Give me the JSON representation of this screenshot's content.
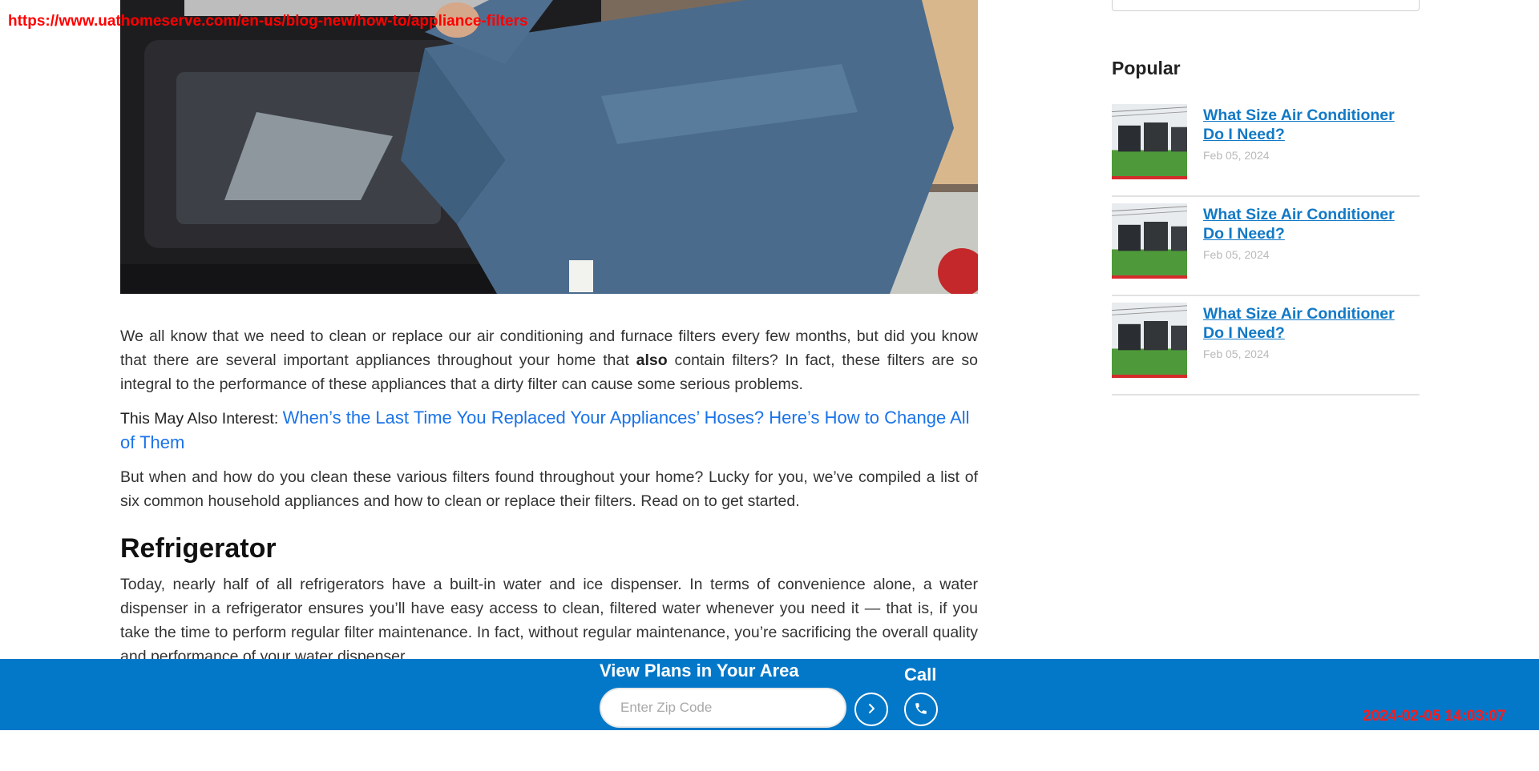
{
  "url_overlay": "https://www.uathomeserve.com/en-us/blog-new/how-to/appliance-filters",
  "article": {
    "para1_part1": "We all know that we need to clean or replace our air conditioning and furnace filters every few months, but did you know that there are several important appliances throughout your home that ",
    "para1_bold": "also",
    "para1_part2": " contain filters? In fact, these filters are so integral to the performance of these appliances that a dirty filter can cause some serious problems.",
    "interest_label": "This May Also Interest: ",
    "interest_link": "When’s the Last Time You Replaced Your Appliances’ Hoses? Here’s How to Change All of Them",
    "para2": "But when and how do you clean these various filters found throughout your home? Lucky for you, we’ve compiled a list of six common household appliances and how to clean or replace their filters. Read on to get started.",
    "section_title": "Refrigerator",
    "para3": "Today, nearly half of all refrigerators have a built-in water and ice dispenser. In terms of convenience alone, a water dispenser in a refrigerator ensures you’ll have easy access to clean, filtered water whenever you need it — that is, if you take the time to perform regular filter maintenance. In fact, without regular maintenance, you’re sacrificing the overall quality and performance of your water dispenser."
  },
  "sidebar": {
    "title": "Popular",
    "items": [
      {
        "title": "What Size Air Conditioner Do I Need?",
        "date": "Feb 05, 2024"
      },
      {
        "title": "What Size Air Conditioner Do I Need?",
        "date": "Feb 05, 2024"
      },
      {
        "title": "What Size Air Conditioner Do I Need?",
        "date": "Feb 05, 2024"
      }
    ]
  },
  "bottom_bar": {
    "plans_label": "View Plans in Your Area",
    "zip_placeholder": "Enter Zip Code",
    "call_label": "Call",
    "go_icon": "chevron-right-icon",
    "call_icon": "phone-icon"
  },
  "timestamp": "2024-02-05 14:03:07",
  "colors": {
    "bar": "#0478c8",
    "link": "#1a73e8",
    "sidebar_link": "#1279c6",
    "overlay_red": "#ff0000"
  }
}
